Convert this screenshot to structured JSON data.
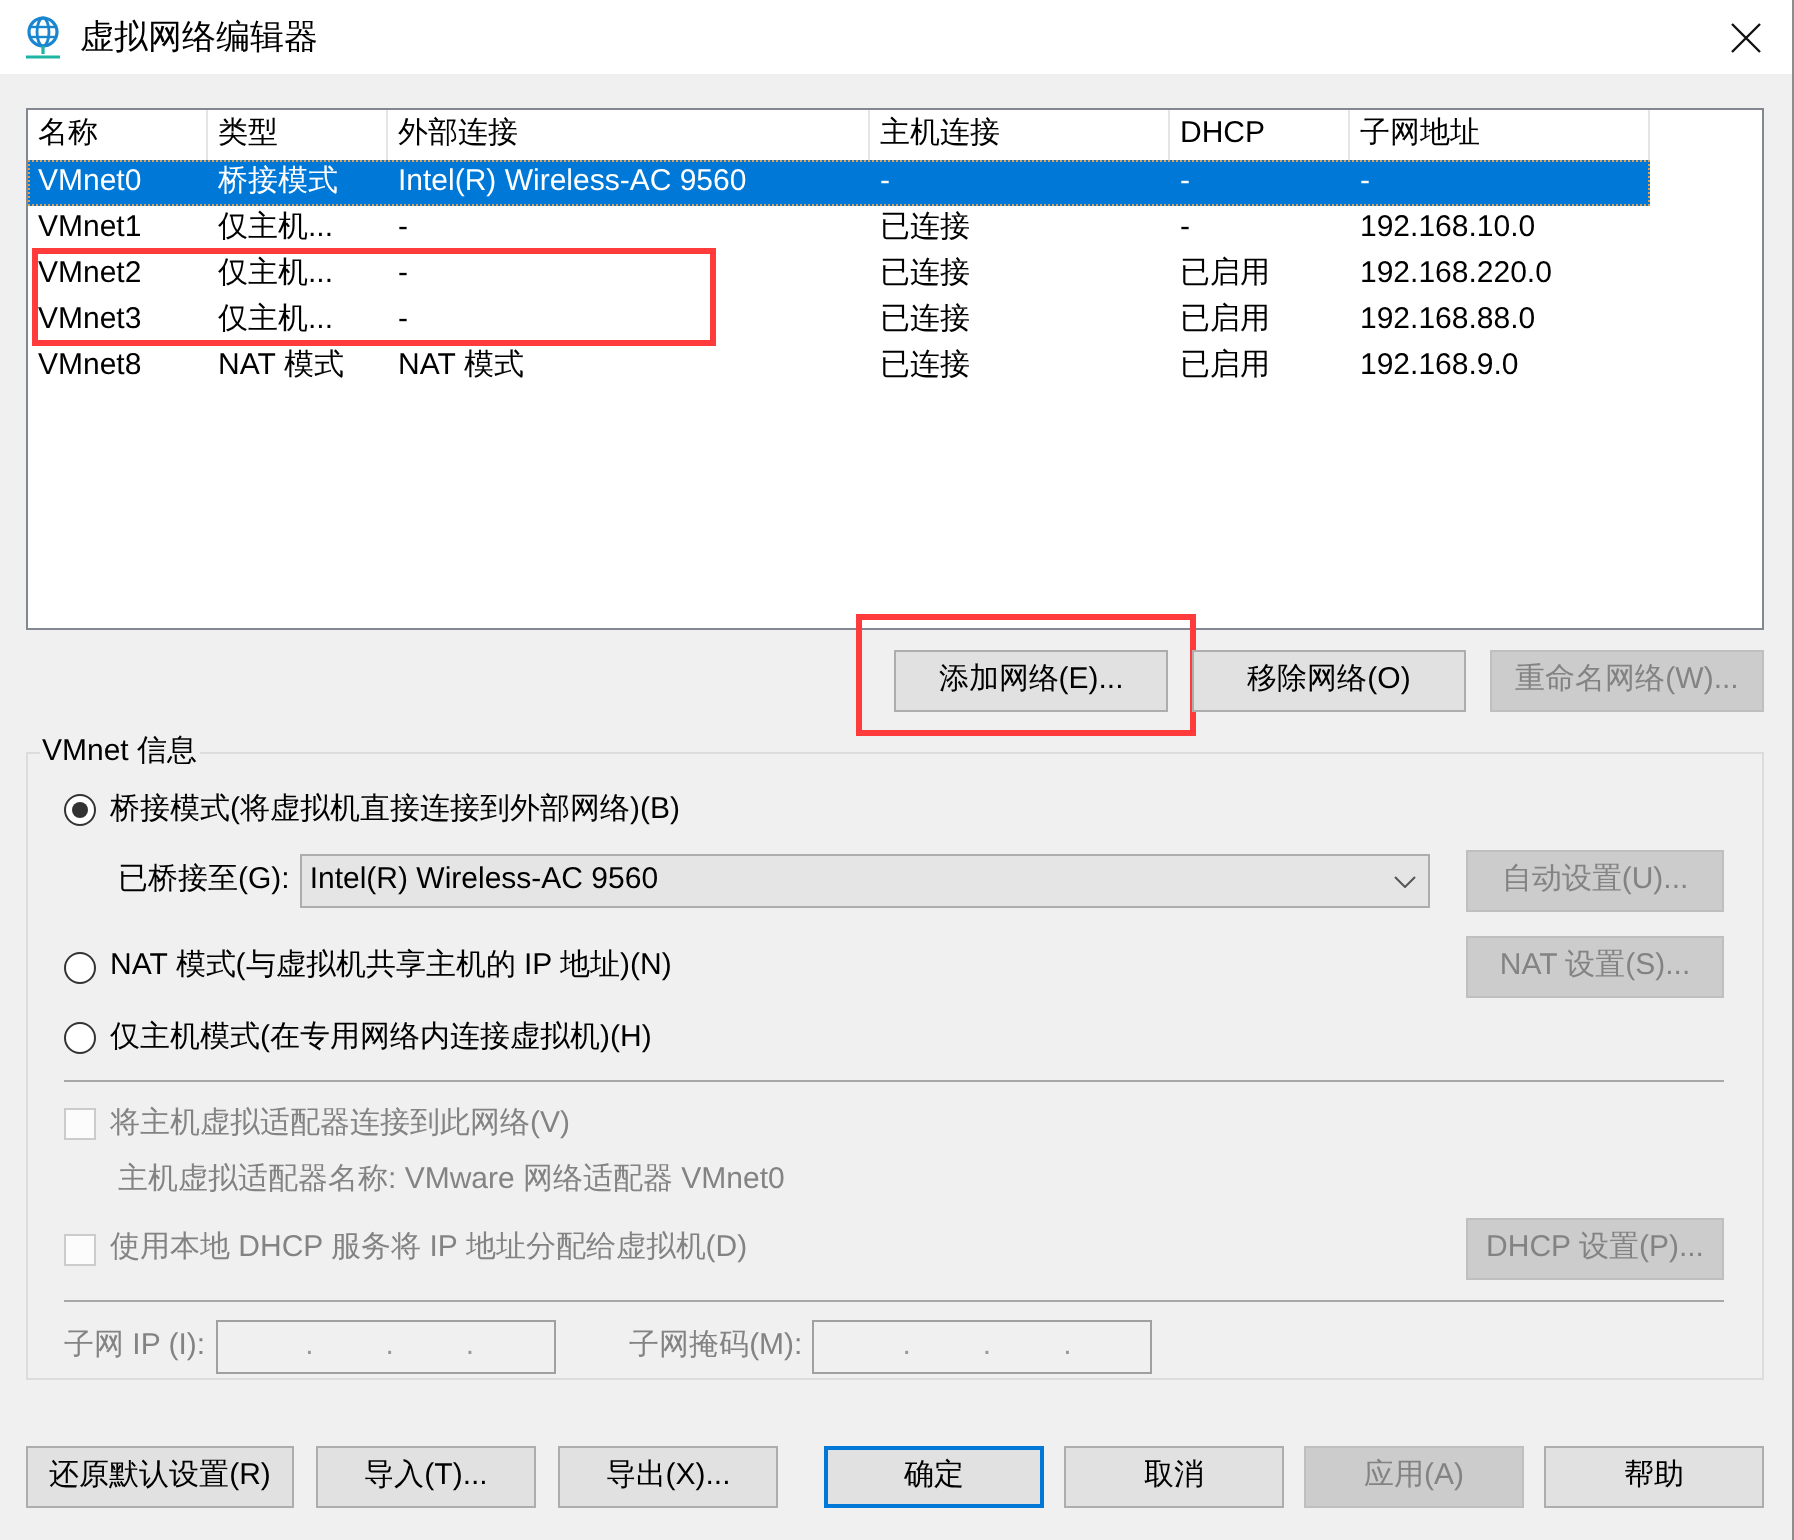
{
  "window": {
    "title": "虚拟网络编辑器"
  },
  "network_table": {
    "columns": [
      "名称",
      "类型",
      "外部连接",
      "主机连接",
      "DHCP",
      "子网地址"
    ],
    "rows": [
      {
        "cells": [
          "VMnet0",
          "桥接模式",
          "Intel(R) Wireless-AC 9560",
          "-",
          "-",
          "-"
        ],
        "selected": true,
        "highlighted": false
      },
      {
        "cells": [
          "VMnet1",
          "仅主机...",
          "-",
          "已连接",
          "-",
          "192.168.10.0"
        ],
        "selected": false,
        "highlighted": false
      },
      {
        "cells": [
          "VMnet2",
          "仅主机...",
          "-",
          "已连接",
          "已启用",
          "192.168.220.0"
        ],
        "selected": false,
        "highlighted": true
      },
      {
        "cells": [
          "VMnet3",
          "仅主机...",
          "-",
          "已连接",
          "已启用",
          "192.168.88.0"
        ],
        "selected": false,
        "highlighted": true
      },
      {
        "cells": [
          "VMnet8",
          "NAT 模式",
          "NAT 模式",
          "已连接",
          "已启用",
          "192.168.9.0"
        ],
        "selected": false,
        "highlighted": false
      }
    ]
  },
  "table_buttons": [
    {
      "label": "添加网络(E)...",
      "disabled": false,
      "highlighted": true
    },
    {
      "label": "移除网络(O)",
      "disabled": false,
      "highlighted": false
    },
    {
      "label": "重命名网络(W)...",
      "disabled": true,
      "highlighted": false
    }
  ],
  "vmnet_info": {
    "title": "VMnet 信息",
    "modes": [
      {
        "kind": "bridged",
        "label": "桥接模式(将虚拟机直接连接到外部网络)(B)",
        "selected": true,
        "bridge_to": {
          "label": "已桥接至(G):",
          "value": "Intel(R) Wireless-AC 9560"
        },
        "button": {
          "label": "自动设置(U)...",
          "disabled": true
        }
      },
      {
        "kind": "nat",
        "label": "NAT 模式(与虚拟机共享主机的 IP 地址)(N)",
        "selected": false,
        "button": {
          "label": "NAT 设置(S)...",
          "disabled": true
        }
      },
      {
        "kind": "host_only",
        "label": "仅主机模式(在专用网络内连接虚拟机)(H)",
        "selected": false
      }
    ],
    "connect_adapter": {
      "label": "将主机虚拟适配器连接到此网络(V)",
      "checked": false,
      "disabled": true,
      "adapter_name": "主机虚拟适配器名称: VMware 网络适配器 VMnet0"
    },
    "use_dhcp": {
      "label": "使用本地 DHCP 服务将 IP 地址分配给虚拟机(D)",
      "checked": false,
      "disabled": true,
      "button": {
        "label": "DHCP 设置(P)...",
        "disabled": true
      }
    },
    "subnet_ip": {
      "label": "子网 IP (I):",
      "separators": [
        ".",
        ".",
        "."
      ],
      "disabled": true
    },
    "subnet_mask": {
      "label": "子网掩码(M):",
      "separators": [
        ".",
        ".",
        "."
      ],
      "disabled": true
    }
  },
  "footer": {
    "left_buttons": [
      {
        "label": "还原默认设置(R)",
        "disabled": false,
        "default": false
      },
      {
        "label": "导入(T)...",
        "disabled": false,
        "default": false
      },
      {
        "label": "导出(X)...",
        "disabled": false,
        "default": false
      }
    ],
    "right_buttons": [
      {
        "label": "确定",
        "disabled": false,
        "default": true
      },
      {
        "label": "取消",
        "disabled": false,
        "default": false
      },
      {
        "label": "应用(A)",
        "disabled": true,
        "default": false
      },
      {
        "label": "帮助",
        "disabled": false,
        "default": false
      }
    ]
  }
}
